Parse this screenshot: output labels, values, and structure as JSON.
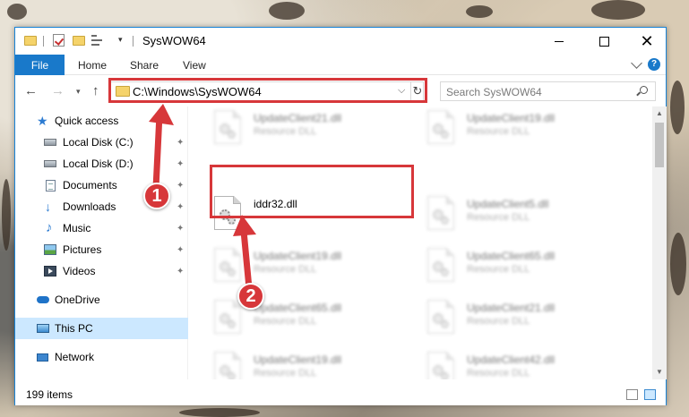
{
  "window": {
    "title": "SysWOW64",
    "controls": {
      "minimize": "minimize",
      "maximize": "maximize",
      "close": "✕"
    }
  },
  "ribbon": {
    "tabs": [
      {
        "label": "File",
        "active": true
      },
      {
        "label": "Home"
      },
      {
        "label": "Share"
      },
      {
        "label": "View"
      }
    ],
    "help": "?"
  },
  "navbar": {
    "back": "←",
    "forward": "→",
    "recent": "▾",
    "up": "↑",
    "address": "C:\\Windows\\SysWOW64",
    "address_drop": "⌵",
    "refresh": "↻",
    "search_placeholder": "Search SysWOW64"
  },
  "nav_pane": {
    "items": [
      {
        "label": "Quick access",
        "icon": "star-icon"
      },
      {
        "label": "Local Disk (C:)",
        "icon": "disk-icon",
        "pinned": true
      },
      {
        "label": "Local Disk (D:)",
        "icon": "disk-icon",
        "pinned": true
      },
      {
        "label": "Documents",
        "icon": "document-icon",
        "pinned": true
      },
      {
        "label": "Downloads",
        "icon": "download-icon",
        "pinned": true
      },
      {
        "label": "Music",
        "icon": "music-icon",
        "pinned": true
      },
      {
        "label": "Pictures",
        "icon": "picture-icon",
        "pinned": true
      },
      {
        "label": "Videos",
        "icon": "video-icon",
        "pinned": true
      },
      {
        "label": "OneDrive",
        "icon": "cloud-icon"
      },
      {
        "label": "This PC",
        "icon": "computer-icon",
        "selected": true
      },
      {
        "label": "Network",
        "icon": "network-icon"
      }
    ],
    "pin_glyph": "📌"
  },
  "files": {
    "left": [
      {
        "name": "UpdateClient21.dll",
        "type": "Resource DLL",
        "blurred": true
      },
      {
        "name": "iddr32.dll",
        "type": "",
        "blurred": false,
        "highlighted": true
      },
      {
        "name": "UpdateClient19.dll",
        "type": "Resource DLL",
        "blurred": true
      },
      {
        "name": "UpdateClient65.dll",
        "type": "Resource DLL",
        "blurred": true
      },
      {
        "name": "UpdateClient19.dll",
        "type": "Resource DLL",
        "blurred": true
      }
    ],
    "right": [
      {
        "name": "UpdateClient19.dll",
        "type": "Resource DLL",
        "blurred": true
      },
      {
        "name": "UpdateClient5.dll",
        "type": "Resource DLL",
        "blurred": true
      },
      {
        "name": "UpdateClient65.dll",
        "type": "Resource DLL",
        "blurred": true
      },
      {
        "name": "UpdateClient21.dll",
        "type": "Resource DLL",
        "blurred": true
      },
      {
        "name": "UpdateClient42.dll",
        "type": "Resource DLL",
        "blurred": true
      }
    ]
  },
  "statusbar": {
    "item_count": "199 items"
  },
  "annotations": {
    "callout_1": "1",
    "callout_2": "2",
    "color": "#d7373a"
  },
  "colors": {
    "accent": "#1979ca",
    "selected": "#cce8ff"
  }
}
